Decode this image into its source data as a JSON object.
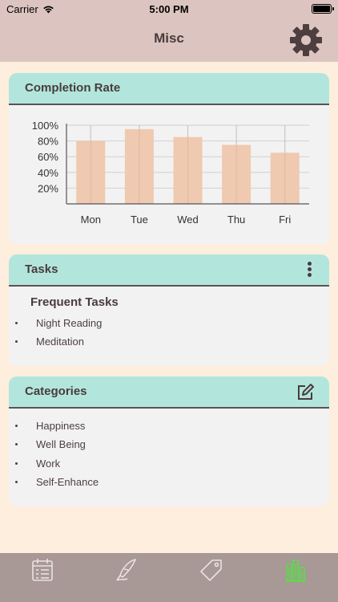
{
  "status_bar": {
    "carrier": "Carrier",
    "time": "5:00 PM"
  },
  "nav": {
    "title": "Misc"
  },
  "completion": {
    "title": "Completion Rate"
  },
  "chart_data": {
    "type": "bar",
    "categories": [
      "Mon",
      "Tue",
      "Wed",
      "Thu",
      "Fri"
    ],
    "values": [
      80,
      95,
      85,
      75,
      65
    ],
    "yticks": [
      "100%",
      "80%",
      "60%",
      "40%",
      "20%"
    ],
    "ylim": [
      0,
      100
    ],
    "grid": true,
    "bar_color": "#efc9b0"
  },
  "tasks": {
    "title": "Tasks",
    "heading": "Frequent Tasks",
    "items": [
      "Night Reading",
      "Meditation"
    ]
  },
  "categories": {
    "title": "Categories",
    "items": [
      "Happiness",
      "Well Being",
      "Work",
      "Self-Enhance"
    ]
  },
  "tab_bar": {
    "tabs": [
      "calendar-icon",
      "quill-icon",
      "tag-icon",
      "stats-icon"
    ],
    "active_index": 3,
    "active_color": "#5bdc4a"
  },
  "colors": {
    "header_bg": "#dcc4c0",
    "page_bg": "#fdeedd",
    "card_header": "#b2e6dc",
    "tab_bar": "#a89896"
  }
}
